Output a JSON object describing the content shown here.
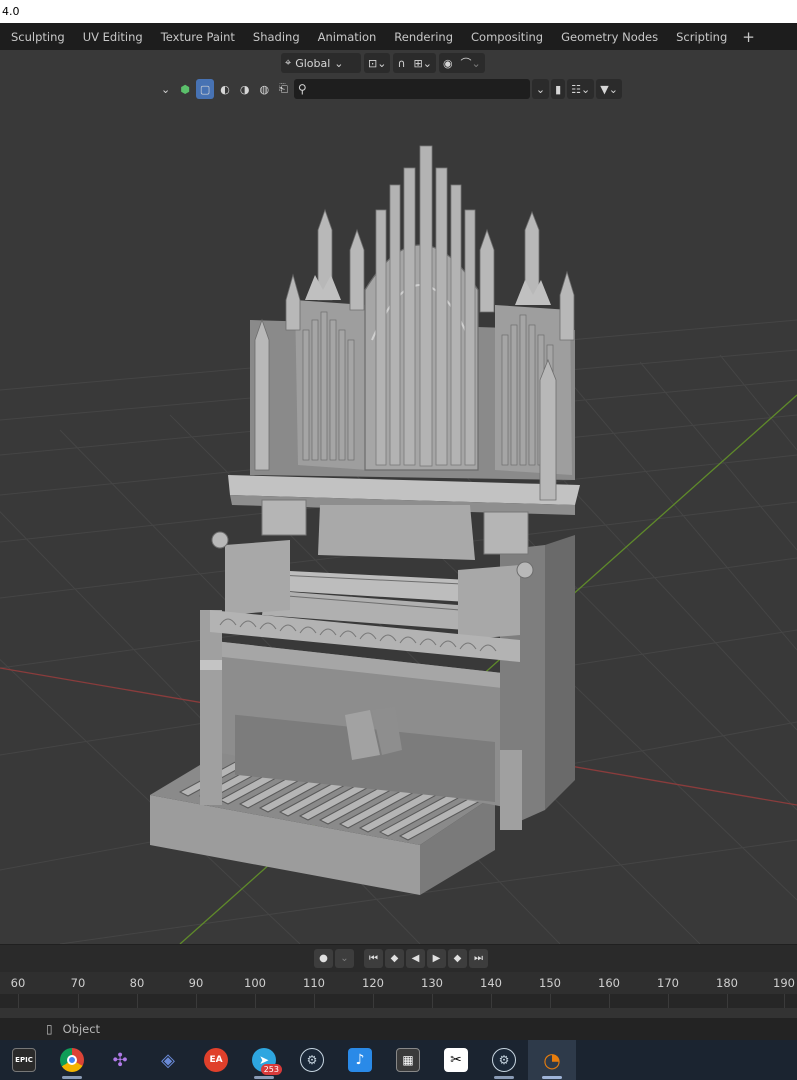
{
  "window": {
    "title": "4.0"
  },
  "workspace_tabs": [
    "Sculpting",
    "UV Editing",
    "Texture Paint",
    "Shading",
    "Animation",
    "Rendering",
    "Compositing",
    "Geometry Nodes",
    "Scripting"
  ],
  "workspace_add": "+",
  "viewport_header": {
    "orientation_label": "Global",
    "search_placeholder": ""
  },
  "timeline": {
    "frame_numbers": [
      "60",
      "70",
      "80",
      "90",
      "100",
      "110",
      "120",
      "130",
      "140",
      "150",
      "160",
      "170",
      "180",
      "190"
    ]
  },
  "statusbar": {
    "mode_label": "Object"
  },
  "taskbar": {
    "apps": [
      {
        "name": "epic-games",
        "label": "EPIC",
        "color": "#2a2a2a"
      },
      {
        "name": "chrome",
        "label": "",
        "color": "#e8b530"
      },
      {
        "name": "game-controller",
        "label": "",
        "color": "#9a5ad8"
      },
      {
        "name": "app-diamond",
        "label": "",
        "color": "#4a6aa8"
      },
      {
        "name": "ea-app",
        "label": "EA",
        "color": "#e0402b"
      },
      {
        "name": "telegram",
        "label": "",
        "color": "#2ea6e0",
        "badge": "253"
      },
      {
        "name": "steam",
        "label": "",
        "color": "#1b2838"
      },
      {
        "name": "music-app",
        "label": "",
        "color": "#2a8ae8"
      },
      {
        "name": "calculator",
        "label": "",
        "color": "#3a3a3a"
      },
      {
        "name": "capcut",
        "label": "",
        "color": "#111111"
      },
      {
        "name": "steam-2",
        "label": "",
        "color": "#1b2838"
      },
      {
        "name": "blender",
        "label": "",
        "color": "#e87d0d"
      }
    ]
  }
}
